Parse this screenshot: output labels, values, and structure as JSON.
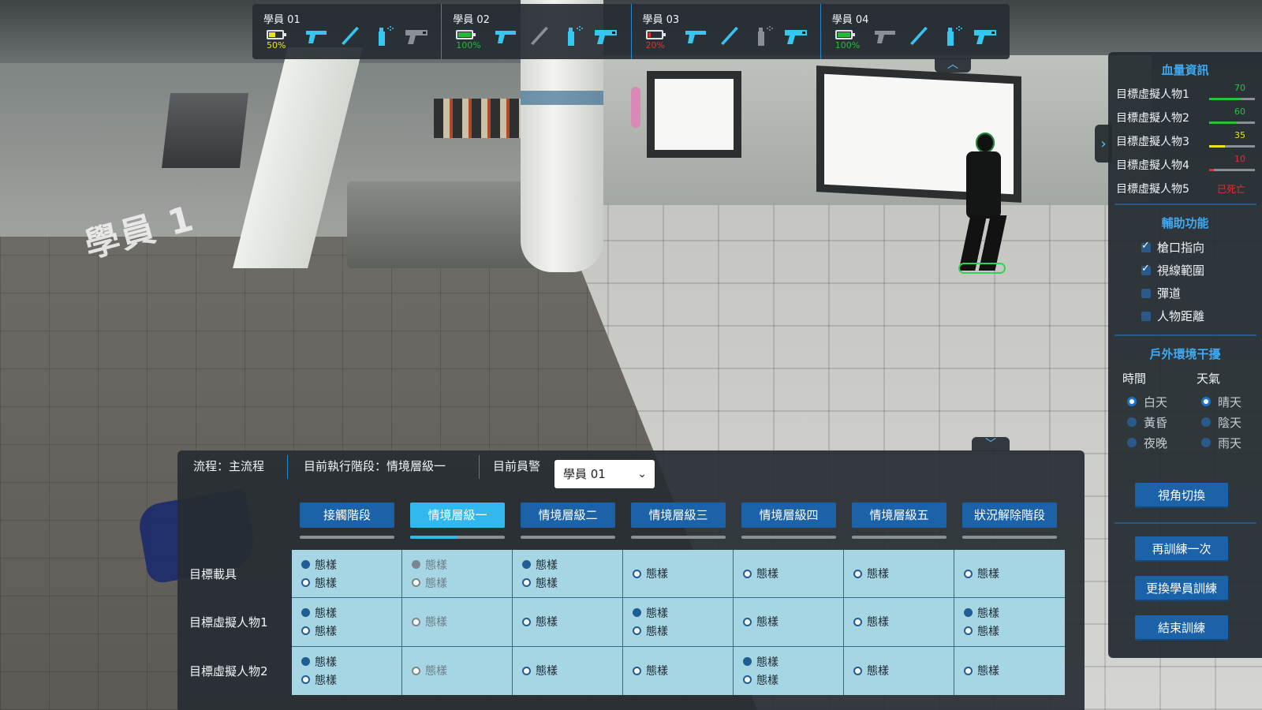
{
  "scene": {
    "student_tag": "學員 1"
  },
  "students": [
    {
      "name": "學員 01",
      "battery_pct": 50,
      "battery_text": "50%",
      "battery_color": "#f0e21a",
      "text_color": "#f0e21a",
      "weapons": [
        {
          "icon": "pistol-icon",
          "color": "#35c7f0"
        },
        {
          "icon": "baton-icon",
          "color": "#35c7f0"
        },
        {
          "icon": "pepper-spray-icon",
          "color": "#35c7f0"
        },
        {
          "icon": "taser-icon",
          "color": "#8a9096"
        }
      ]
    },
    {
      "name": "學員 02",
      "battery_pct": 100,
      "battery_text": "100%",
      "battery_color": "#27b83a",
      "text_color": "#27b83a",
      "weapons": [
        {
          "icon": "pistol-icon",
          "color": "#35c7f0"
        },
        {
          "icon": "baton-icon",
          "color": "#8a9096"
        },
        {
          "icon": "pepper-spray-icon",
          "color": "#35c7f0"
        },
        {
          "icon": "taser-icon",
          "color": "#35c7f0"
        }
      ]
    },
    {
      "name": "學員 03",
      "battery_pct": 20,
      "battery_text": "20%",
      "battery_color": "#e0312b",
      "text_color": "#e0312b",
      "weapons": [
        {
          "icon": "pistol-icon",
          "color": "#35c7f0"
        },
        {
          "icon": "baton-icon",
          "color": "#35c7f0"
        },
        {
          "icon": "pepper-spray-icon",
          "color": "#8a9096"
        },
        {
          "icon": "taser-icon",
          "color": "#35c7f0"
        }
      ]
    },
    {
      "name": "學員 04",
      "battery_pct": 100,
      "battery_text": "100%",
      "battery_color": "#27b83a",
      "text_color": "#27b83a",
      "weapons": [
        {
          "icon": "pistol-icon",
          "color": "#8a9096"
        },
        {
          "icon": "baton-icon",
          "color": "#35c7f0"
        },
        {
          "icon": "pepper-spray-icon",
          "color": "#35c7f0"
        },
        {
          "icon": "taser-icon",
          "color": "#35c7f0"
        }
      ]
    }
  ],
  "right_panel": {
    "hp_title": "血量資訊",
    "targets": [
      {
        "name": "目標虛擬人物1",
        "hp": 70,
        "hp_text": "70",
        "color": "#27c23c"
      },
      {
        "name": "目標虛擬人物2",
        "hp": 60,
        "hp_text": "60",
        "color": "#27c23c"
      },
      {
        "name": "目標虛擬人物3",
        "hp": 35,
        "hp_text": "35",
        "color": "#f0e21a"
      },
      {
        "name": "目標虛擬人物4",
        "hp": 10,
        "hp_text": "10",
        "color": "#e0312b"
      },
      {
        "name": "目標虛擬人物5",
        "hp": 0,
        "dead_text": "已死亡",
        "color": "#e0312b"
      }
    ],
    "aux_title": "輔助功能",
    "aux": [
      {
        "label": "槍口指向",
        "checked": true
      },
      {
        "label": "視線範圍",
        "checked": true
      },
      {
        "label": "彈道",
        "checked": false
      },
      {
        "label": "人物距離",
        "checked": false
      }
    ],
    "env_title": "戶外環境干擾",
    "time_head": "時間",
    "time_opts": [
      {
        "label": "白天",
        "on": true
      },
      {
        "label": "黃昏",
        "on": false
      },
      {
        "label": "夜晚",
        "on": false
      }
    ],
    "weather_head": "天氣",
    "weather_opts": [
      {
        "label": "晴天",
        "on": true
      },
      {
        "label": "陰天",
        "on": false
      },
      {
        "label": "雨天",
        "on": false
      }
    ],
    "view_switch": "視角切換",
    "retrain": "再訓練一次",
    "change_student": "更換學員訓練",
    "end_training": "結束訓練"
  },
  "control": {
    "flow": "流程：主流程",
    "current_stage": "目前執行階段：情境層級一",
    "current_officer_label": "目前員警",
    "current_officer_value": "學員 01",
    "stages": [
      {
        "label": "接觸階段",
        "active": false
      },
      {
        "label": "情境層級一",
        "active": true,
        "progress": 0.5
      },
      {
        "label": "情境層級二",
        "active": false
      },
      {
        "label": "情境層級三",
        "active": false
      },
      {
        "label": "情境層級四",
        "active": false
      },
      {
        "label": "情境層級五",
        "active": false
      },
      {
        "label": "狀況解除階段",
        "active": false
      }
    ],
    "rows": [
      {
        "label": "目標載具",
        "cells": [
          [
            {
              "t": "態樣",
              "f": true
            },
            {
              "t": "態樣",
              "f": false
            }
          ],
          [
            {
              "t": "態樣",
              "f": true,
              "dim": true
            },
            {
              "t": "態樣",
              "f": false,
              "dim": true
            }
          ],
          [
            {
              "t": "態樣",
              "f": true
            },
            {
              "t": "態樣",
              "f": false
            }
          ],
          [
            {
              "t": "態樣",
              "f": false
            }
          ],
          [
            {
              "t": "態樣",
              "f": false
            }
          ],
          [
            {
              "t": "態樣",
              "f": false
            }
          ],
          [
            {
              "t": "態樣",
              "f": false
            }
          ]
        ]
      },
      {
        "label": "目標虛擬人物1",
        "cells": [
          [
            {
              "t": "態樣",
              "f": true
            },
            {
              "t": "態樣",
              "f": false
            }
          ],
          [
            {
              "t": "態樣",
              "f": false,
              "dim": true
            }
          ],
          [
            {
              "t": "態樣",
              "f": false
            }
          ],
          [
            {
              "t": "態樣",
              "f": true
            },
            {
              "t": "態樣",
              "f": false
            }
          ],
          [
            {
              "t": "態樣",
              "f": false
            }
          ],
          [
            {
              "t": "態樣",
              "f": false
            }
          ],
          [
            {
              "t": "態樣",
              "f": true
            },
            {
              "t": "態樣",
              "f": false
            }
          ]
        ]
      },
      {
        "label": "目標虛擬人物2",
        "cells": [
          [
            {
              "t": "態樣",
              "f": true
            },
            {
              "t": "態樣",
              "f": false
            }
          ],
          [
            {
              "t": "態樣",
              "f": false,
              "dim": true
            }
          ],
          [
            {
              "t": "態樣",
              "f": false
            }
          ],
          [
            {
              "t": "態樣",
              "f": false
            }
          ],
          [
            {
              "t": "態樣",
              "f": true
            },
            {
              "t": "態樣",
              "f": false
            }
          ],
          [
            {
              "t": "態樣",
              "f": false
            }
          ],
          [
            {
              "t": "態樣",
              "f": false
            }
          ]
        ]
      }
    ]
  }
}
